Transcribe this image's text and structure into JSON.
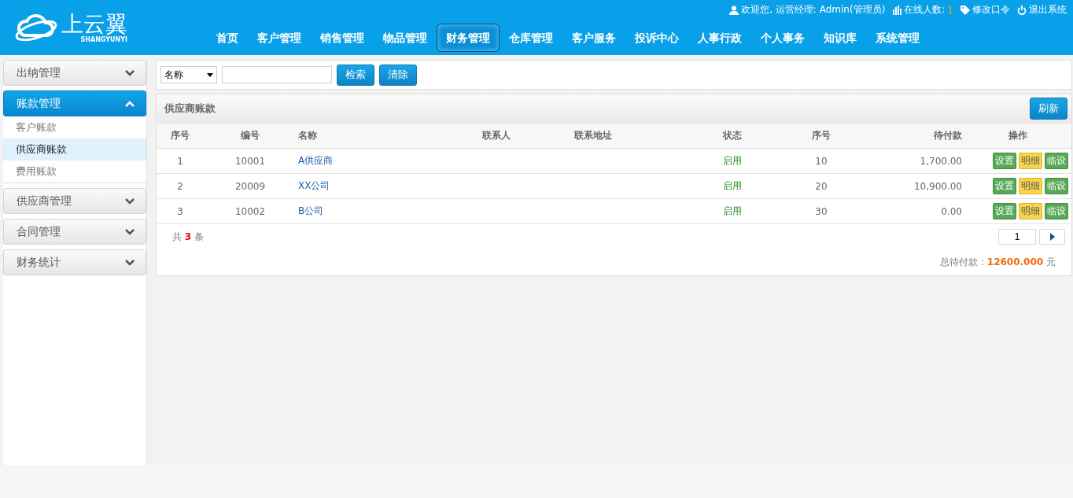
{
  "header": {
    "logo_text": "上云翼",
    "logo_subtext": "SHANGYUNYI",
    "user_bar": {
      "welcome": "欢迎您, 运营经理: Admin(管理员)",
      "online_label": "在线人数:",
      "online_count": "1",
      "change_password": "修改口令",
      "logout": "退出系统"
    },
    "nav": [
      {
        "label": "首页",
        "selected": false
      },
      {
        "label": "客户管理",
        "selected": false
      },
      {
        "label": "销售管理",
        "selected": false
      },
      {
        "label": "物品管理",
        "selected": false
      },
      {
        "label": "财务管理",
        "selected": true
      },
      {
        "label": "仓库管理",
        "selected": false
      },
      {
        "label": "客户服务",
        "selected": false
      },
      {
        "label": "投诉中心",
        "selected": false
      },
      {
        "label": "人事行政",
        "selected": false
      },
      {
        "label": "个人事务",
        "selected": false
      },
      {
        "label": "知识库",
        "selected": false
      },
      {
        "label": "系统管理",
        "selected": false
      }
    ]
  },
  "sidebar": {
    "groups": [
      {
        "label": "出纳管理",
        "expanded": false
      },
      {
        "label": "账款管理",
        "expanded": true,
        "children": [
          {
            "label": "客户账款",
            "selected": false
          },
          {
            "label": "供应商账款",
            "selected": true
          },
          {
            "label": "费用账款",
            "selected": false
          }
        ]
      },
      {
        "label": "供应商管理",
        "expanded": false
      },
      {
        "label": "合同管理",
        "expanded": false
      },
      {
        "label": "财务统计",
        "expanded": false
      }
    ]
  },
  "search": {
    "field_select": "名称",
    "search_button": "检索",
    "clear_button": "清除"
  },
  "panel": {
    "title": "供应商账款",
    "refresh_button": "刷新",
    "table": {
      "columns": [
        "序号",
        "编号",
        "名称",
        "联系人",
        "联系地址",
        "状态",
        "序号",
        "待付款",
        "操作"
      ],
      "rows": [
        {
          "index": "1",
          "code": "10001",
          "name": "A供应商",
          "status": "启用",
          "order": "10",
          "payable": "1,700.00",
          "actions": [
            {
              "label": "设置",
              "kind": "primary"
            },
            {
              "label": "明细",
              "kind": "warning"
            },
            {
              "label": "临设",
              "kind": "primary"
            }
          ]
        },
        {
          "index": "2",
          "code": "20009",
          "name": "XX公司",
          "status": "启用",
          "order": "20",
          "payable": "10,900.00",
          "actions": [
            {
              "label": "设置",
              "kind": "primary"
            },
            {
              "label": "明细",
              "kind": "warning"
            },
            {
              "label": "临设",
              "kind": "primary"
            }
          ]
        },
        {
          "index": "3",
          "code": "10002",
          "name": "B公司",
          "status": "启用",
          "order": "30",
          "payable": "0.00",
          "actions": [
            {
              "label": "设置",
              "kind": "primary"
            },
            {
              "label": "明细",
              "kind": "warning"
            },
            {
              "label": "临设",
              "kind": "primary"
            }
          ]
        }
      ]
    },
    "count": {
      "prefix": "共",
      "value": "3",
      "suffix": "条"
    },
    "pagination": {
      "page": "1"
    },
    "total": {
      "label": "总待付款：",
      "value": "12600.000",
      "unit": "元"
    }
  }
}
